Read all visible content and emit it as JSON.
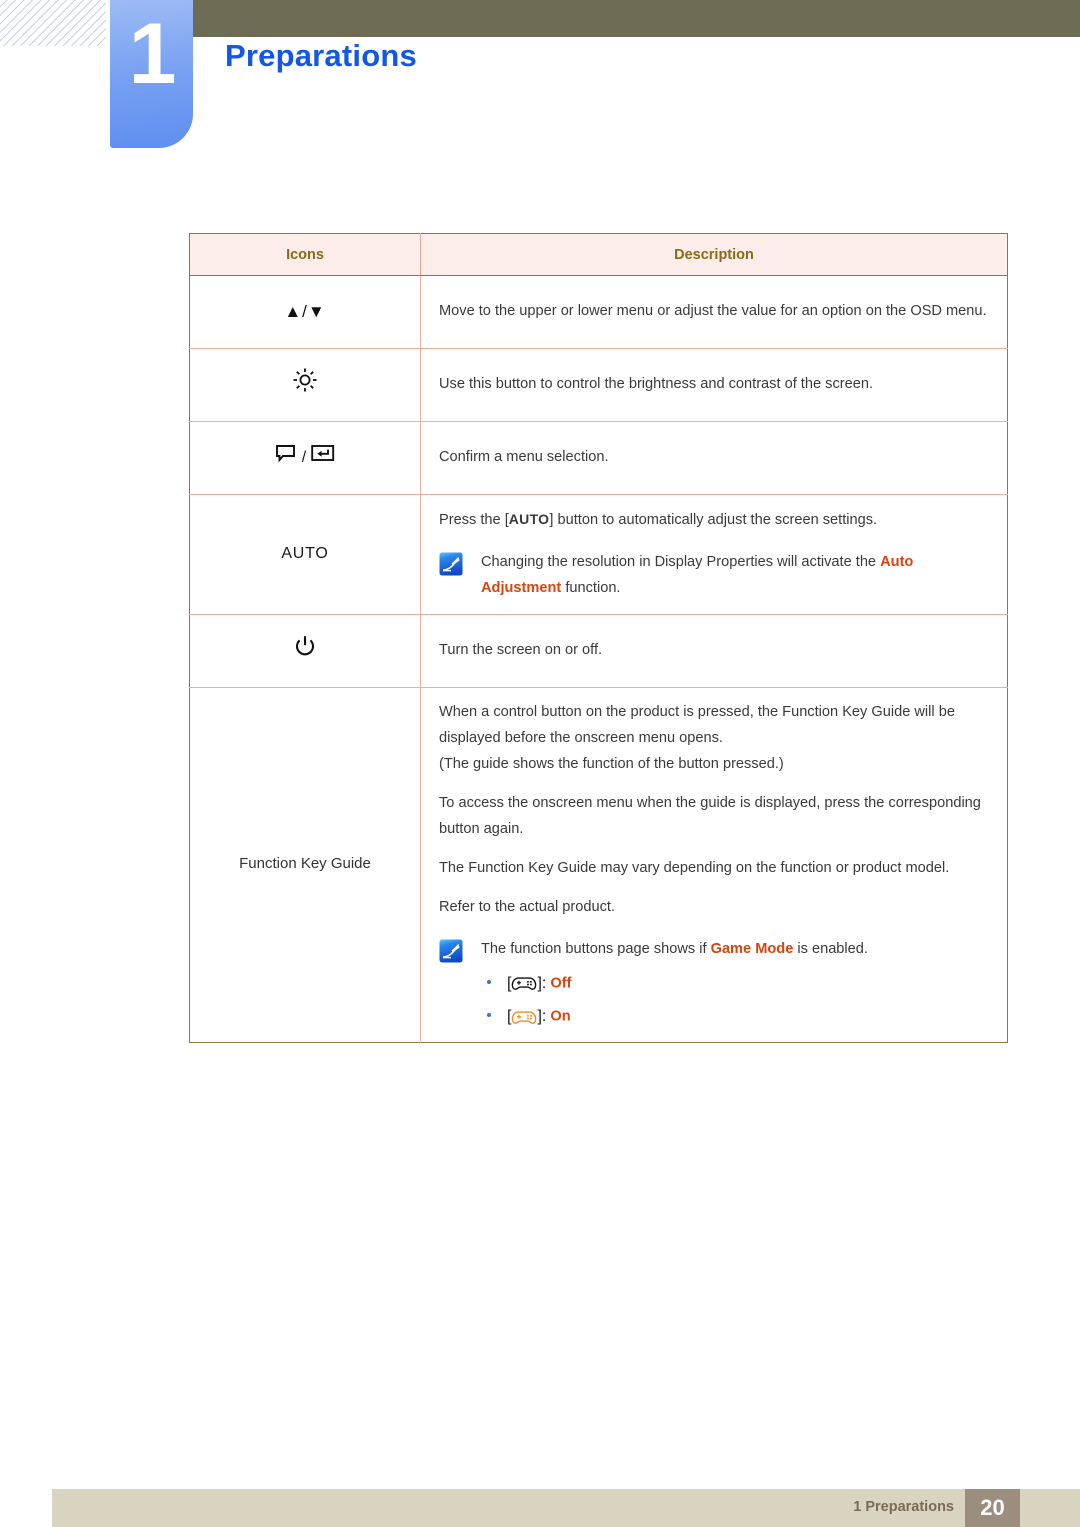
{
  "header": {
    "chapter_number": "1",
    "chapter_title": "Preparations"
  },
  "table": {
    "columns": [
      "Icons",
      "Description"
    ],
    "rows": [
      {
        "icon_name": "up-down-arrows-icon",
        "icon_text": "▲/▼",
        "paragraphs": [
          "Move to the upper or lower menu or adjust the value for an option on the OSD menu."
        ]
      },
      {
        "icon_name": "brightness-sun-icon",
        "icon_text": "",
        "paragraphs": [
          "Use this button to control the brightness and contrast of the screen."
        ]
      },
      {
        "icon_name": "menu-enter-icon",
        "icon_text": "",
        "paragraphs": [
          "Confirm a menu selection."
        ]
      },
      {
        "icon_name": "auto-button-icon",
        "icon_text": "AUTO",
        "paragraphs": [
          "Press the [AUTO] button to automatically adjust the screen settings."
        ],
        "note": {
          "icon_name": "note-pen-icon",
          "text_before": "Changing the resolution in Display Properties will activate the ",
          "highlight": "Auto Adjustment",
          "text_after": " function."
        }
      },
      {
        "icon_name": "power-icon",
        "icon_text": "",
        "paragraphs": [
          "Turn the screen on or off."
        ]
      },
      {
        "icon_name": "function-key-guide-label",
        "icon_text": "Function Key Guide",
        "paragraphs": [
          "When a control button on the product is pressed, the Function Key Guide will be displayed before the onscreen menu opens.",
          "(The guide shows the function of the button pressed.)",
          "To access the onscreen menu when the guide is displayed, press the corresponding button again.",
          "The Function Key Guide may vary depending on the function or product model.",
          "Refer to the actual product."
        ],
        "note": {
          "icon_name": "note-pen-icon",
          "text_before": "The function buttons page shows if ",
          "highlight": "Game Mode",
          "text_after": " is enabled.",
          "bullets": [
            {
              "icon_name": "gamepad-off-icon",
              "state": "Off"
            },
            {
              "icon_name": "gamepad-on-icon",
              "state": "On"
            }
          ]
        }
      }
    ]
  },
  "footer": {
    "text": "1 Preparations",
    "page_number": "20"
  },
  "colors": {
    "chapter_title": "#1357e8",
    "header_bar": "#6e6b54",
    "tab_blue": "#7ba3f2",
    "table_border": "#8a7a3f",
    "table_header_bg": "#fdeeec",
    "table_header_text": "#8a6a15",
    "highlight_red": "#d8450e",
    "footer_bg": "#d9d4c0",
    "footer_text": "#7b6a55",
    "page_badge_bg": "#9b8e7e"
  }
}
